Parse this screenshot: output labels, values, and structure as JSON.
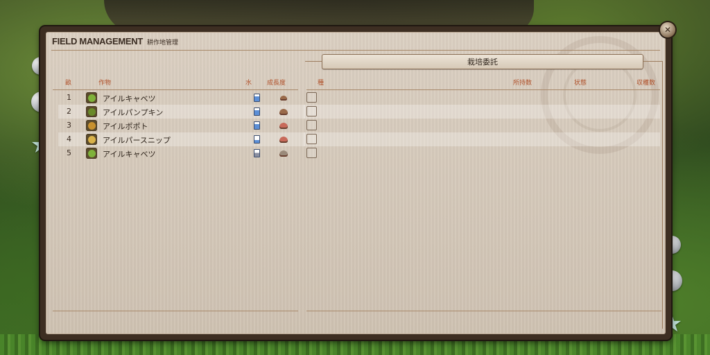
{
  "window": {
    "title_en": "FIELD MANAGEMENT",
    "title_jp": "耕作地管理"
  },
  "left_pane": {
    "headers": {
      "bed": "畝",
      "crop": "作物",
      "water": "水",
      "growth": "成長度"
    },
    "rows": [
      {
        "num": "1",
        "crop": "アイルキャベツ",
        "crop_icon": "cabbage-icon",
        "icon_color": "#7fb23a"
      },
      {
        "num": "2",
        "crop": "アイルパンプキン",
        "crop_icon": "pumpkin-icon",
        "icon_color": "#6a8a2a"
      },
      {
        "num": "3",
        "crop": "アイルポポト",
        "crop_icon": "potato-icon",
        "icon_color": "#c8912e"
      },
      {
        "num": "4",
        "crop": "アイルパースニップ",
        "crop_icon": "parsnip-icon",
        "icon_color": "#d9b24a"
      },
      {
        "num": "5",
        "crop": "アイルキャベツ",
        "crop_icon": "cabbage-icon",
        "icon_color": "#7fb23a"
      }
    ]
  },
  "right_pane": {
    "commission_label": "栽培委託",
    "headers": {
      "seed": "種",
      "owned": "所持数",
      "status": "状態",
      "yield": "収穫数"
    }
  },
  "colors": {
    "header_text": "#b0512a",
    "parchment": "#d6cabb",
    "frame": "#3d2e22"
  }
}
